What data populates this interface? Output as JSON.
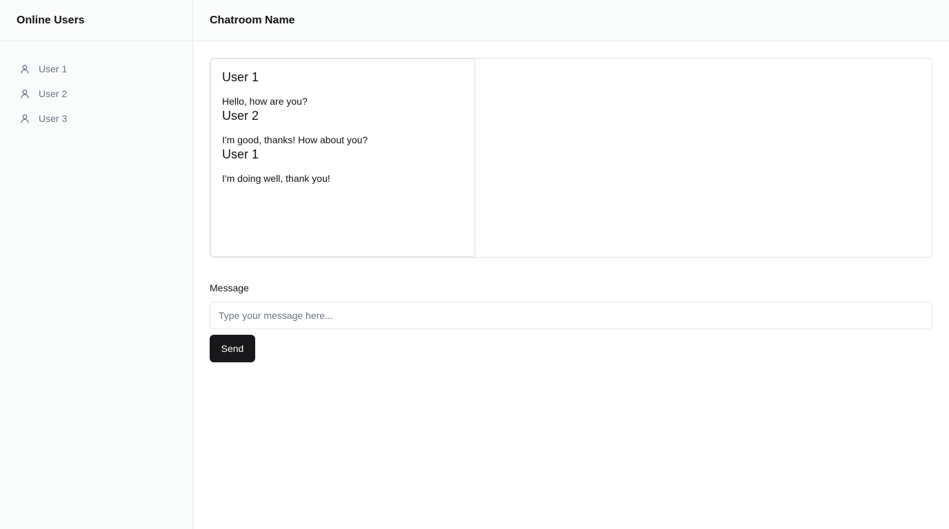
{
  "sidebar": {
    "title": "Online Users",
    "users": [
      {
        "label": "User 1",
        "icon": "user-icon"
      },
      {
        "label": "User 2",
        "icon": "user-icon"
      },
      {
        "label": "User 3",
        "icon": "user-icon"
      }
    ]
  },
  "header": {
    "room_name": "Chatroom Name"
  },
  "chat": {
    "messages": [
      {
        "author": "User 1",
        "text": "Hello, how are you?"
      },
      {
        "author": "User 2",
        "text": "I'm good, thanks! How about you?"
      },
      {
        "author": "User 1",
        "text": "I'm doing well, thank you!"
      }
    ]
  },
  "composer": {
    "label": "Message",
    "placeholder": "Type your message here...",
    "value": "",
    "send_label": "Send"
  },
  "colors": {
    "sidebar_bg": "#fafbfb",
    "border": "#e6e8ea",
    "muted_text": "#6b7280",
    "button_bg": "#18181b",
    "button_text": "#ffffff"
  }
}
